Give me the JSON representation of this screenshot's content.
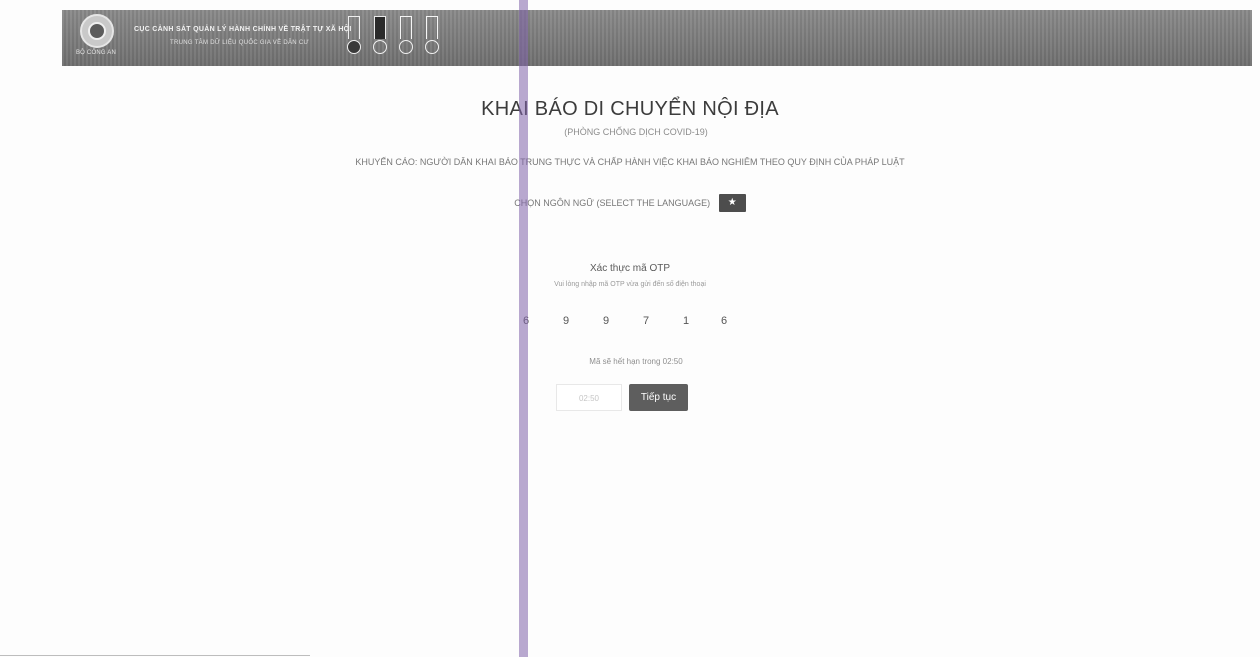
{
  "header": {
    "emblem_caption": "BỘ CÔNG AN",
    "org_name": "CỤC CẢNH SÁT QUẢN LÝ HÀNH CHÍNH VỀ TRẬT TỰ XÃ HỘI",
    "org_subtitle": "TRUNG TÂM DỮ LIỆU QUỐC GIA VỀ DÂN CƯ",
    "medal_icons": [
      "medal-icon",
      "medal-icon",
      "medal-icon",
      "medal-icon"
    ]
  },
  "main": {
    "title": "KHAI BÁO DI CHUYỂN NỘI ĐỊA",
    "subtitle": "(PHÒNG CHỐNG DỊCH COVID-19)",
    "warning": "KHUYẾN CÁO: NGƯỜI DÂN KHAI BÁO TRUNG THỰC VÀ CHẤP HÀNH VIỆC KHAI BÁO NGHIÊM THEO QUY ĐỊNH CỦA PHÁP LUẬT",
    "language_label": "CHỌN NGÔN NGỮ (SELECT THE LANGUAGE)",
    "language_button": "★"
  },
  "otp": {
    "title": "Xác thực mã OTP",
    "hint": "Vui lòng nhập mã OTP vừa gửi đến số điện thoại",
    "digits": [
      "6",
      "9",
      "9",
      "7",
      "1",
      "6"
    ],
    "expire_text": "Mã sẽ hết hạn trong 02:50",
    "resend_label": "02:50",
    "continue_label": "Tiếp tục"
  },
  "colors": {
    "banner": "#7f7f7f",
    "button_dark": "#5e5e5e",
    "scan_artifact": "#8062aa"
  }
}
